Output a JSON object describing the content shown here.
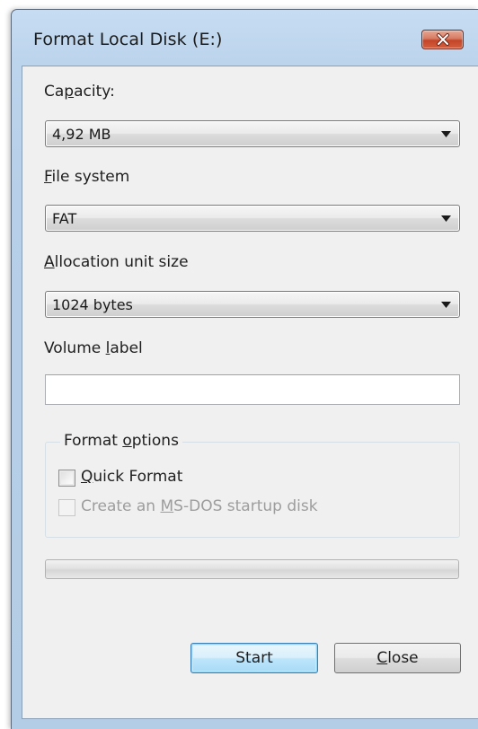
{
  "window": {
    "title": "Format Local Disk (E:)"
  },
  "capacity": {
    "label_pre": "Ca",
    "label_accel": "p",
    "label_post": "acity:",
    "value": "4,92 MB"
  },
  "file_system": {
    "label_accel": "F",
    "label_post": "ile system",
    "value": "FAT"
  },
  "allocation": {
    "label_accel": "A",
    "label_post": "llocation unit size",
    "value": "1024 bytes"
  },
  "volume_label": {
    "label_pre": "Volume ",
    "label_accel": "l",
    "label_post": "abel",
    "value": ""
  },
  "format_options": {
    "legend_pre": "Format ",
    "legend_accel": "o",
    "legend_post": "ptions",
    "quick_format": {
      "label_accel": "Q",
      "label_post": "uick Format",
      "checked": false
    },
    "msdos": {
      "label_pre": "Create an ",
      "label_accel": "M",
      "label_post": "S-DOS startup disk",
      "checked": false,
      "enabled": false
    }
  },
  "progress": {
    "fraction": 0
  },
  "buttons": {
    "start": "Start",
    "close_accel": "C",
    "close_post": "lose"
  },
  "icons": {
    "close": "close-x-icon",
    "dropdown": "chevron-down-icon"
  }
}
